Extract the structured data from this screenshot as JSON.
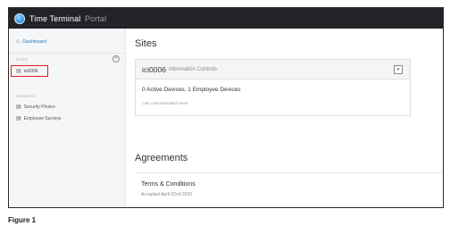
{
  "app": {
    "brand_name": "Time Terminal",
    "brand_suffix": "Portal"
  },
  "sidebar": {
    "dashboard_label": "Dashboard",
    "sites_section_label": "SITES",
    "add_icon": "plus-circle-icon",
    "sites": [
      {
        "label": "ici0006",
        "selected": true
      }
    ],
    "surveys_section_label": "SURVEYS",
    "surveys": [
      {
        "label": "Security Photos"
      },
      {
        "label": "Employee Surveys"
      }
    ]
  },
  "main": {
    "sites_heading": "Sites",
    "site_card": {
      "name": "ici0006",
      "subtitle": "Information Controls",
      "devices_summary": "0 Active Devices, 1 Employee Devices",
      "last_communicated": "Last communicated never"
    },
    "agreements_heading": "Agreements",
    "agreement": {
      "title": "Terms & Conditions",
      "accepted": "Accepted April 22nd 2020"
    }
  },
  "caption": "Figure 1",
  "colors": {
    "topbar": "#222326",
    "accent": "#2a7ec6",
    "highlight_border": "#e0211d"
  }
}
